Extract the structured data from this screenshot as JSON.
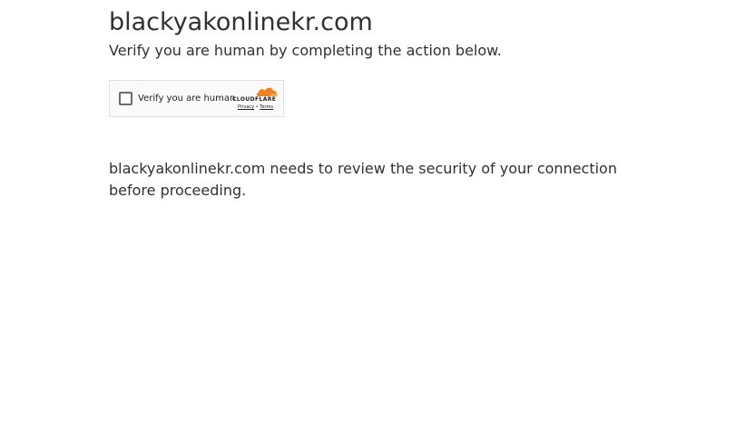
{
  "page": {
    "site_title": "blackyakonlinekr.com",
    "subtitle": "Verify you are human by completing the action below.",
    "message": "blackyakonlinekr.com needs to review the security of your connection before proceeding."
  },
  "widget": {
    "checkbox_label": "Verify you are human",
    "brand": "CLOUDFLARE",
    "privacy_link": "Privacy",
    "separator": "•",
    "terms_link": "Terms",
    "brand_color": "#f38020"
  }
}
